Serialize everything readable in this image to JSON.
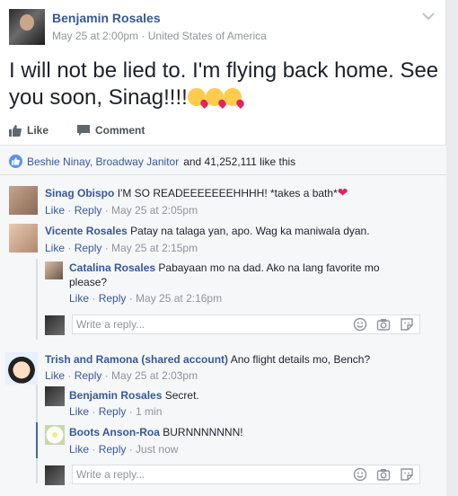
{
  "post": {
    "author": "Benjamin Rosales",
    "date": "May 25 at 2:00pm",
    "location": "United States of America",
    "text": "I will not be lied to. I'm flying back home. See you soon, Sinag!!!!",
    "emojis": [
      "kissing-face-heart-icon",
      "kissing-face-heart-icon",
      "kissing-face-heart-icon"
    ]
  },
  "actions": {
    "like_label": "Like",
    "comment_label": "Comment"
  },
  "likes": {
    "names": "Beshie Ninay, Broadway Janitor",
    "rest": "and 41,252,111 like this"
  },
  "comments": [
    {
      "author": "Sinag Obispo",
      "text": "I'M SO READEEEEEEEHHHH! *takes a bath*",
      "like": "Like",
      "reply": "Reply",
      "time": "May 25 at 2:05pm"
    },
    {
      "author": "Vicente Rosales",
      "text": "Patay na talaga yan, apo. Wag ka maniwala dyan.",
      "like": "Like",
      "reply": "Reply",
      "time": "May 25 at 2:15pm",
      "replies": [
        {
          "author": "Catalina Rosales",
          "text": "Pabayaan mo na dad. Ako na lang favorite mo",
          "text2": "please?",
          "like": "Like",
          "reply": "Reply",
          "time": "May 25 at 2:16pm"
        }
      ]
    },
    {
      "author": "Trish and Ramona (shared account)",
      "text": "Ano flight details mo, Bench?",
      "like": "Like",
      "reply": "Reply",
      "time": "May 25 at 2:03pm",
      "replies": [
        {
          "author": "Benjamin Rosales",
          "text": "Secret.",
          "like": "Like",
          "reply": "Reply",
          "time": "1 min"
        },
        {
          "author": "Boots Anson-Roa",
          "text": "BURNNNNNNN!",
          "like": "Like",
          "reply": "Reply",
          "time": "Just now"
        }
      ]
    }
  ],
  "reply_input": {
    "placeholder": "Write a reply..."
  },
  "colors": {
    "link": "#365899",
    "meta": "#90949c",
    "like_badge": "#5890ff"
  }
}
